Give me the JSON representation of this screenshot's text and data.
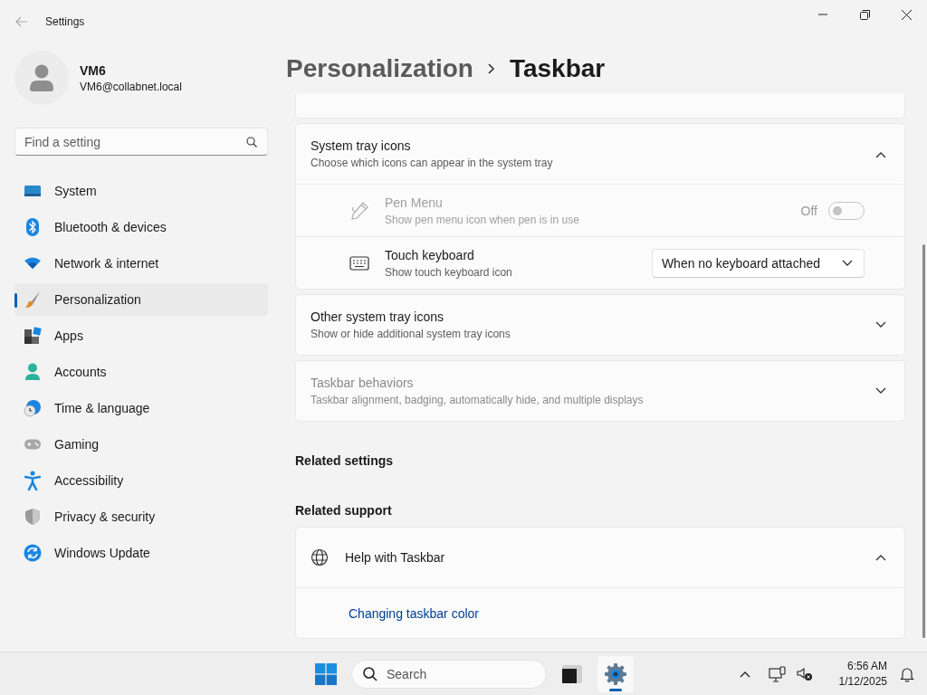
{
  "window": {
    "title": "Settings"
  },
  "account": {
    "name": "VM6",
    "email": "VM6@collabnet.local"
  },
  "search": {
    "placeholder": "Find a setting"
  },
  "nav": [
    {
      "label": "System",
      "kind": "system",
      "selected": false
    },
    {
      "label": "Bluetooth & devices",
      "kind": "bluetooth",
      "selected": false
    },
    {
      "label": "Network & internet",
      "kind": "wifi",
      "selected": false
    },
    {
      "label": "Personalization",
      "kind": "brush",
      "selected": true
    },
    {
      "label": "Apps",
      "kind": "apps",
      "selected": false
    },
    {
      "label": "Accounts",
      "kind": "person",
      "selected": false
    },
    {
      "label": "Time & language",
      "kind": "clock",
      "selected": false
    },
    {
      "label": "Gaming",
      "kind": "gamepad",
      "selected": false
    },
    {
      "label": "Accessibility",
      "kind": "accessibility",
      "selected": false
    },
    {
      "label": "Privacy & security",
      "kind": "shield",
      "selected": false
    },
    {
      "label": "Windows Update",
      "kind": "update",
      "selected": false
    }
  ],
  "breadcrumb": [
    "Personalization",
    "Taskbar"
  ],
  "tray_group": {
    "title": "System tray icons",
    "subtitle": "Choose which icons can appear in the system tray",
    "expanded": true,
    "items": [
      {
        "kind": "toggle",
        "title": "Pen Menu",
        "subtitle": "Show pen menu icon when pen is in use",
        "disabled": true,
        "on": false,
        "state_label": "Off"
      },
      {
        "kind": "dropdown",
        "title": "Touch keyboard",
        "subtitle": "Show touch keyboard icon",
        "disabled": false,
        "value": "When no keyboard attached"
      }
    ]
  },
  "sections": [
    {
      "title": "Other system tray icons",
      "subtitle": "Show or hide additional system tray icons",
      "expanded": false,
      "disabled": false
    },
    {
      "title": "Taskbar behaviors",
      "subtitle": "Taskbar alignment, badging, automatically hide, and multiple displays",
      "expanded": false,
      "disabled": true
    }
  ],
  "related_settings": {
    "heading": "Related settings"
  },
  "related_support": {
    "heading": "Related support",
    "title": "Help with Taskbar",
    "expanded": true,
    "links": [
      "Changing taskbar color"
    ]
  },
  "taskbar": {
    "search_placeholder": "Search",
    "apps": [
      {
        "kind": "terminal",
        "active": false
      },
      {
        "kind": "settings",
        "active": true
      }
    ],
    "time": "6:56 AM",
    "date": "1/12/2025"
  }
}
